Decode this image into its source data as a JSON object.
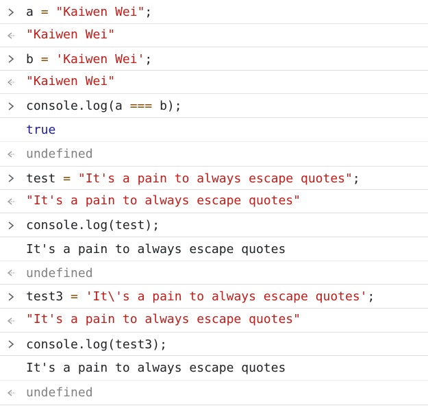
{
  "console": {
    "entries": [
      {
        "kind": "input",
        "parts": [
          {
            "text": "a ",
            "c": "plain"
          },
          {
            "text": "=",
            "c": "op"
          },
          {
            "text": " ",
            "c": "plain"
          },
          {
            "text": "\"Kaiwen Wei\"",
            "c": "str"
          },
          {
            "text": ";",
            "c": "plain"
          }
        ]
      },
      {
        "kind": "result",
        "parts": [
          {
            "text": "\"Kaiwen Wei\"",
            "c": "str"
          }
        ]
      },
      {
        "kind": "input",
        "parts": [
          {
            "text": "b ",
            "c": "plain"
          },
          {
            "text": "=",
            "c": "op"
          },
          {
            "text": " ",
            "c": "plain"
          },
          {
            "text": "'Kaiwen Wei'",
            "c": "str"
          },
          {
            "text": ";",
            "c": "plain"
          }
        ]
      },
      {
        "kind": "result",
        "parts": [
          {
            "text": "\"Kaiwen Wei\"",
            "c": "str"
          }
        ]
      },
      {
        "kind": "input",
        "parts": [
          {
            "text": "console.log(a ",
            "c": "plain"
          },
          {
            "text": "===",
            "c": "op"
          },
          {
            "text": " b);",
            "c": "plain"
          }
        ]
      },
      {
        "kind": "log",
        "parts": [
          {
            "text": "true",
            "c": "kw"
          }
        ]
      },
      {
        "kind": "result",
        "parts": [
          {
            "text": "undefined",
            "c": "muted"
          }
        ]
      },
      {
        "kind": "input",
        "parts": [
          {
            "text": "test ",
            "c": "plain"
          },
          {
            "text": "=",
            "c": "op"
          },
          {
            "text": " ",
            "c": "plain"
          },
          {
            "text": "\"It's a pain to always escape quotes\"",
            "c": "str"
          },
          {
            "text": ";",
            "c": "plain"
          }
        ]
      },
      {
        "kind": "result",
        "parts": [
          {
            "text": "\"It's a pain to always escape quotes\"",
            "c": "str"
          }
        ]
      },
      {
        "kind": "input",
        "parts": [
          {
            "text": "console.log(test);",
            "c": "plain"
          }
        ]
      },
      {
        "kind": "log",
        "parts": [
          {
            "text": "It's a pain to always escape quotes",
            "c": "plain"
          }
        ]
      },
      {
        "kind": "result",
        "parts": [
          {
            "text": "undefined",
            "c": "muted"
          }
        ]
      },
      {
        "kind": "input",
        "parts": [
          {
            "text": "test3 ",
            "c": "plain"
          },
          {
            "text": "=",
            "c": "op"
          },
          {
            "text": " ",
            "c": "plain"
          },
          {
            "text": "'It\\'s a pain to always escape quotes'",
            "c": "str"
          },
          {
            "text": ";",
            "c": "plain"
          }
        ]
      },
      {
        "kind": "result",
        "parts": [
          {
            "text": "\"It's a pain to always escape quotes\"",
            "c": "str"
          }
        ]
      },
      {
        "kind": "input",
        "parts": [
          {
            "text": "console.log(test3);",
            "c": "plain"
          }
        ]
      },
      {
        "kind": "log",
        "parts": [
          {
            "text": "It's a pain to always escape quotes",
            "c": "plain"
          }
        ]
      },
      {
        "kind": "result",
        "parts": [
          {
            "text": "undefined",
            "c": "muted"
          }
        ]
      }
    ]
  },
  "colors": {
    "string": "#c41a16",
    "operator": "#8a4b00",
    "keyword": "#1a1aa6",
    "muted": "#808080",
    "divider": "#e0e0e0"
  },
  "icons": {
    "input": "chevron-right-icon",
    "result": "return-arrow-icon"
  }
}
